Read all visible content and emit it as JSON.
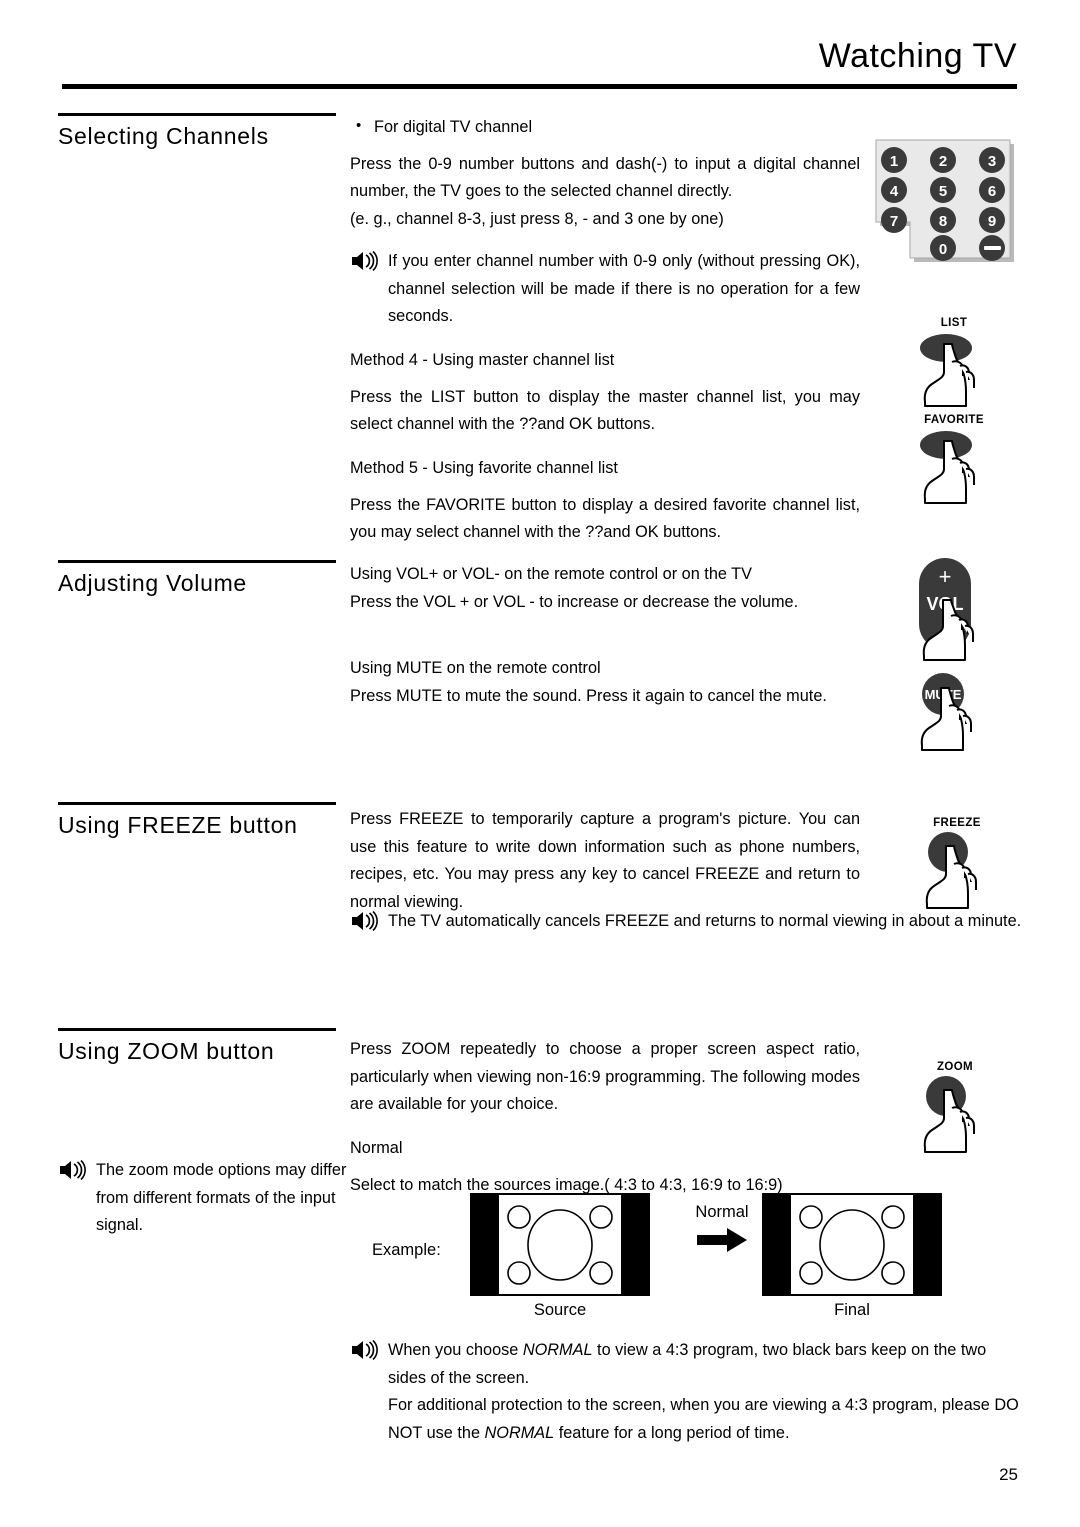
{
  "header": {
    "title": "Watching TV"
  },
  "sections": [
    {
      "id": "selecting-channels",
      "heading": "Selecting Channels",
      "bullet": "For digital TV channel",
      "paragraphs": [
        "Press the 0-9 number buttons and dash(-) to input a digital channel number, the TV goes to the selected channel directly.",
        "(e. g., channel 8-3, just press 8, - and 3 one by one)"
      ],
      "note": "If you enter channel number with 0-9 only (without pressing OK), channel selection will be made if there is no operation for a few seconds.",
      "method4_title": "Method 4 - Using master channel list",
      "method4_body": "Press the LIST button to display the master channel list, you may select channel with the ??and OK buttons.",
      "method5_title": "Method 5 - Using favorite channel list",
      "method5_body": "Press the FAVORITE button to display a desired favorite channel list, you may select channel with the ??and OK buttons."
    },
    {
      "id": "adjusting-volume",
      "heading": "Adjusting Volume",
      "sub1_title": "Using VOL+ or VOL- on the remote control or on the TV",
      "sub1_body": "Press the VOL + or VOL - to increase or decrease the volume.",
      "sub2_title": "Using MUTE on the remote control",
      "sub2_body": "Press MUTE to mute the sound. Press it again to cancel the mute."
    },
    {
      "id": "using-freeze-button",
      "heading": "Using FREEZE button",
      "body": "Press FREEZE to temporarily capture a program's picture. You can use this feature to write down information such as phone numbers, recipes, etc. You may press any key to cancel FREEZE and return to normal viewing.",
      "note": "The TV automatically cancels FREEZE and returns to normal viewing in about a minute."
    },
    {
      "id": "using-zoom-button",
      "heading": "Using ZOOM button",
      "body": "Press ZOOM repeatedly to choose a proper screen aspect ratio, particularly when viewing non-16:9 programming. The following modes are available for your choice.",
      "mode_title": "Normal",
      "mode_body": "Select to match the sources image.( 4:3 to 4:3, 16:9 to 16:9)",
      "side_note": "The zoom mode options may differ from different formats of the input signal."
    }
  ],
  "keypad": {
    "keys": [
      "1",
      "2",
      "3",
      "4",
      "5",
      "6",
      "7",
      "8",
      "9",
      "0",
      "–"
    ]
  },
  "button_illustrations": [
    {
      "name": "list-button",
      "caption": "LIST"
    },
    {
      "name": "favorite-button",
      "caption": "FAVORITE"
    },
    {
      "name": "volume-button",
      "caption_plus": "+",
      "caption_vol": "VOL",
      "caption_minus": "-"
    },
    {
      "name": "mute-button",
      "caption": "MUTE"
    },
    {
      "name": "freeze-button",
      "caption": "FREEZE"
    },
    {
      "name": "zoom-button",
      "caption": "ZOOM"
    }
  ],
  "tv_example": {
    "example_label": "Example:",
    "source_caption": "Source",
    "final_caption": "Final",
    "arrow_label": "Normal"
  },
  "bottom_note": {
    "line1_a": "When you choose ",
    "line1_italic": "NORMAL",
    "line1_b": " to view a 4:3 program, two black bars keep on the two sides of the screen.",
    "line2_a": "For additional protection to the screen, when you are viewing a 4:3 program, please DO NOT use the ",
    "line2_italic": "NORMAL",
    "line2_b": " feature for a long period of time."
  },
  "page_number": "25"
}
